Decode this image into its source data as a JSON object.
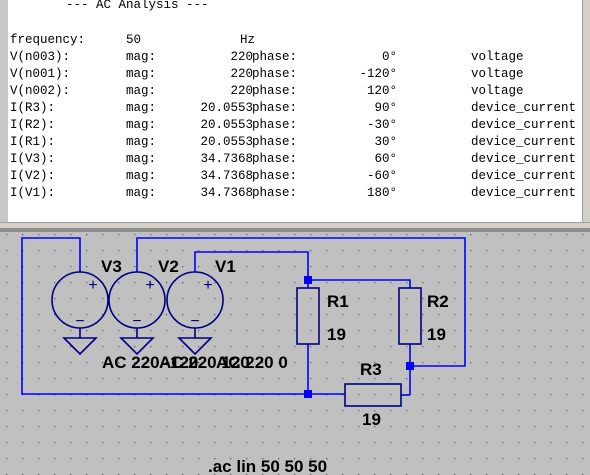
{
  "log": {
    "header": "--- AC Analysis ---",
    "frequency": {
      "label": "frequency:",
      "value": "50",
      "unit": "Hz"
    },
    "rows": [
      {
        "name": "V(n003):",
        "mag_label": "mag:",
        "mag": "220",
        "phase_label": "phase:",
        "phase": "0°",
        "type": "voltage"
      },
      {
        "name": "V(n001):",
        "mag_label": "mag:",
        "mag": "220",
        "phase_label": "phase:",
        "phase": "-120°",
        "type": "voltage"
      },
      {
        "name": "V(n002):",
        "mag_label": "mag:",
        "mag": "220",
        "phase_label": "phase:",
        "phase": "120°",
        "type": "voltage"
      },
      {
        "name": "I(R3):",
        "mag_label": "mag:",
        "mag": "20.0553",
        "phase_label": "phase:",
        "phase": "90°",
        "type": "device_current"
      },
      {
        "name": "I(R2):",
        "mag_label": "mag:",
        "mag": "20.0553",
        "phase_label": "phase:",
        "phase": "-30°",
        "type": "device_current"
      },
      {
        "name": "I(R1):",
        "mag_label": "mag:",
        "mag": "20.0553",
        "phase_label": "phase:",
        "phase": "30°",
        "type": "device_current"
      },
      {
        "name": "I(V3):",
        "mag_label": "mag:",
        "mag": "34.7368",
        "phase_label": "phase:",
        "phase": "60°",
        "type": "device_current"
      },
      {
        "name": "I(V2):",
        "mag_label": "mag:",
        "mag": "34.7368",
        "phase_label": "phase:",
        "phase": "-60°",
        "type": "device_current"
      },
      {
        "name": "I(V1):",
        "mag_label": "mag:",
        "mag": "34.7368",
        "phase_label": "phase:",
        "phase": "180°",
        "type": "device_current"
      }
    ]
  },
  "schematic": {
    "sources": [
      {
        "name": "V3",
        "plus": "+",
        "minus": "−"
      },
      {
        "name": "V2",
        "plus": "+",
        "minus": "−"
      },
      {
        "name": "V1",
        "plus": "+",
        "minus": "−"
      }
    ],
    "source_values": [
      "AC 220 -120",
      "AC 220 120",
      "AC 220 0"
    ],
    "resistors": [
      {
        "name": "R1",
        "value": "19"
      },
      {
        "name": "R2",
        "value": "19"
      },
      {
        "name": "R3",
        "value": "19"
      }
    ],
    "directive": ".ac lin 50 50 50",
    "colors": {
      "wire": "#0000ff",
      "symbol": "#000080",
      "node": "#0000ff",
      "background": "#c0c0c0"
    }
  }
}
